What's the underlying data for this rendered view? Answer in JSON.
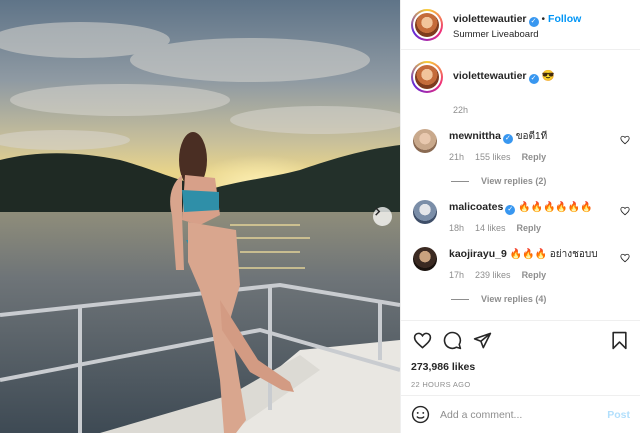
{
  "header": {
    "username": "violettewautier",
    "separator": "•",
    "follow_label": "Follow",
    "location": "Summer Liveaboard"
  },
  "caption": {
    "username": "violettewautier",
    "emoji": "😎",
    "time": "22h"
  },
  "comments": [
    {
      "username": "mewnittha",
      "text": "ขอตี1ที",
      "time": "21h",
      "likes": "155 likes",
      "reply_label": "Reply",
      "view_replies": "View replies (2)",
      "avatar_color": "#c9a98c"
    },
    {
      "username": "malicoates",
      "text": "🔥🔥🔥🔥🔥🔥",
      "time": "18h",
      "likes": "14 likes",
      "reply_label": "Reply",
      "view_replies": "",
      "avatar_color": "#7b8ea8"
    },
    {
      "username": "kaojirayu_9",
      "text": "🔥🔥🔥 อย่างชอบบ",
      "time": "17h",
      "likes": "239 likes",
      "reply_label": "Reply",
      "view_replies": "View replies (4)",
      "avatar_color": "#3b2a22"
    }
  ],
  "actions": {
    "likes": "273,986 likes",
    "posted_ago": "22 HOURS AGO"
  },
  "add_comment": {
    "placeholder": "Add a comment...",
    "post_label": "Post"
  },
  "colors": {
    "link_blue": "#0095f6",
    "verified": "#3897f0",
    "muted": "#8e8e8e"
  },
  "icons": [
    "verified-badge-icon",
    "next-arrow-icon",
    "heart-icon",
    "comment-icon",
    "share-icon",
    "bookmark-icon",
    "emoji-icon"
  ]
}
